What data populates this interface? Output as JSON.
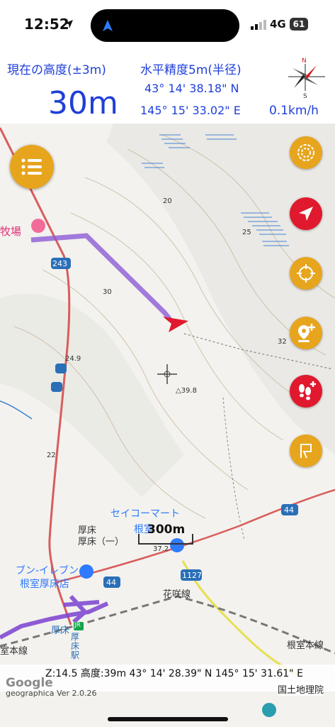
{
  "status_bar": {
    "time": "12:52",
    "network": "4G",
    "battery": "61"
  },
  "info": {
    "altitude_label": "現在の高度(±3m)",
    "altitude_value": "30m",
    "accuracy_label": "水平精度5m(半径)",
    "latitude": "43° 14' 38.18\" N",
    "longitude": "145° 15' 33.02\" E",
    "speed": "0.1km/h",
    "compass_letters": {
      "n": "N",
      "s": "S"
    }
  },
  "map": {
    "labels": {
      "place_ranch": "牧場",
      "route_243": "243",
      "seicomart": "セイコーマート",
      "seicomart_sub": "根室",
      "atsutoko": "厚床",
      "atsutoko_sub": "厚床（一）",
      "seven_eleven": "ブン-イレブン",
      "seven_eleven_sub": "根室厚床店",
      "route_44": "44",
      "route_1127": "1127",
      "kasaku_line": "花咲線",
      "atsutoko_station": "厚床",
      "atsutoko_station_v": "厚床駅",
      "nemuro_line": "根室本線",
      "nemuro_line_left": "室本線",
      "elev_20": "20",
      "elev_25": "25",
      "elev_30": "30",
      "elev_32": "32",
      "elev_24": "24.9",
      "elev_39": "△39.8",
      "elev_22": "22",
      "elev_37": "37.2",
      "scale": "300m",
      "jr": "JR"
    },
    "colors": {
      "route": "#8c5bd6",
      "accent": "#e7a51e",
      "alert": "#e0192e",
      "road": "#d95c5c"
    }
  },
  "buttons": {
    "menu": "menu-icon",
    "layers": "swirl-icon",
    "navigate": "navigation-arrow-icon",
    "locate": "crosshair-target-icon",
    "add_pin": "add-pin-icon",
    "footprints": "footprints-icon",
    "flag": "flag-icon"
  },
  "bottom": {
    "coords": "Z:14.5 高度:39m  43° 14' 28.39\" N 145° 15' 31.61\" E",
    "google": "Google",
    "version": "geographica Ver 2.0.26",
    "attribution": "国土地理院"
  }
}
